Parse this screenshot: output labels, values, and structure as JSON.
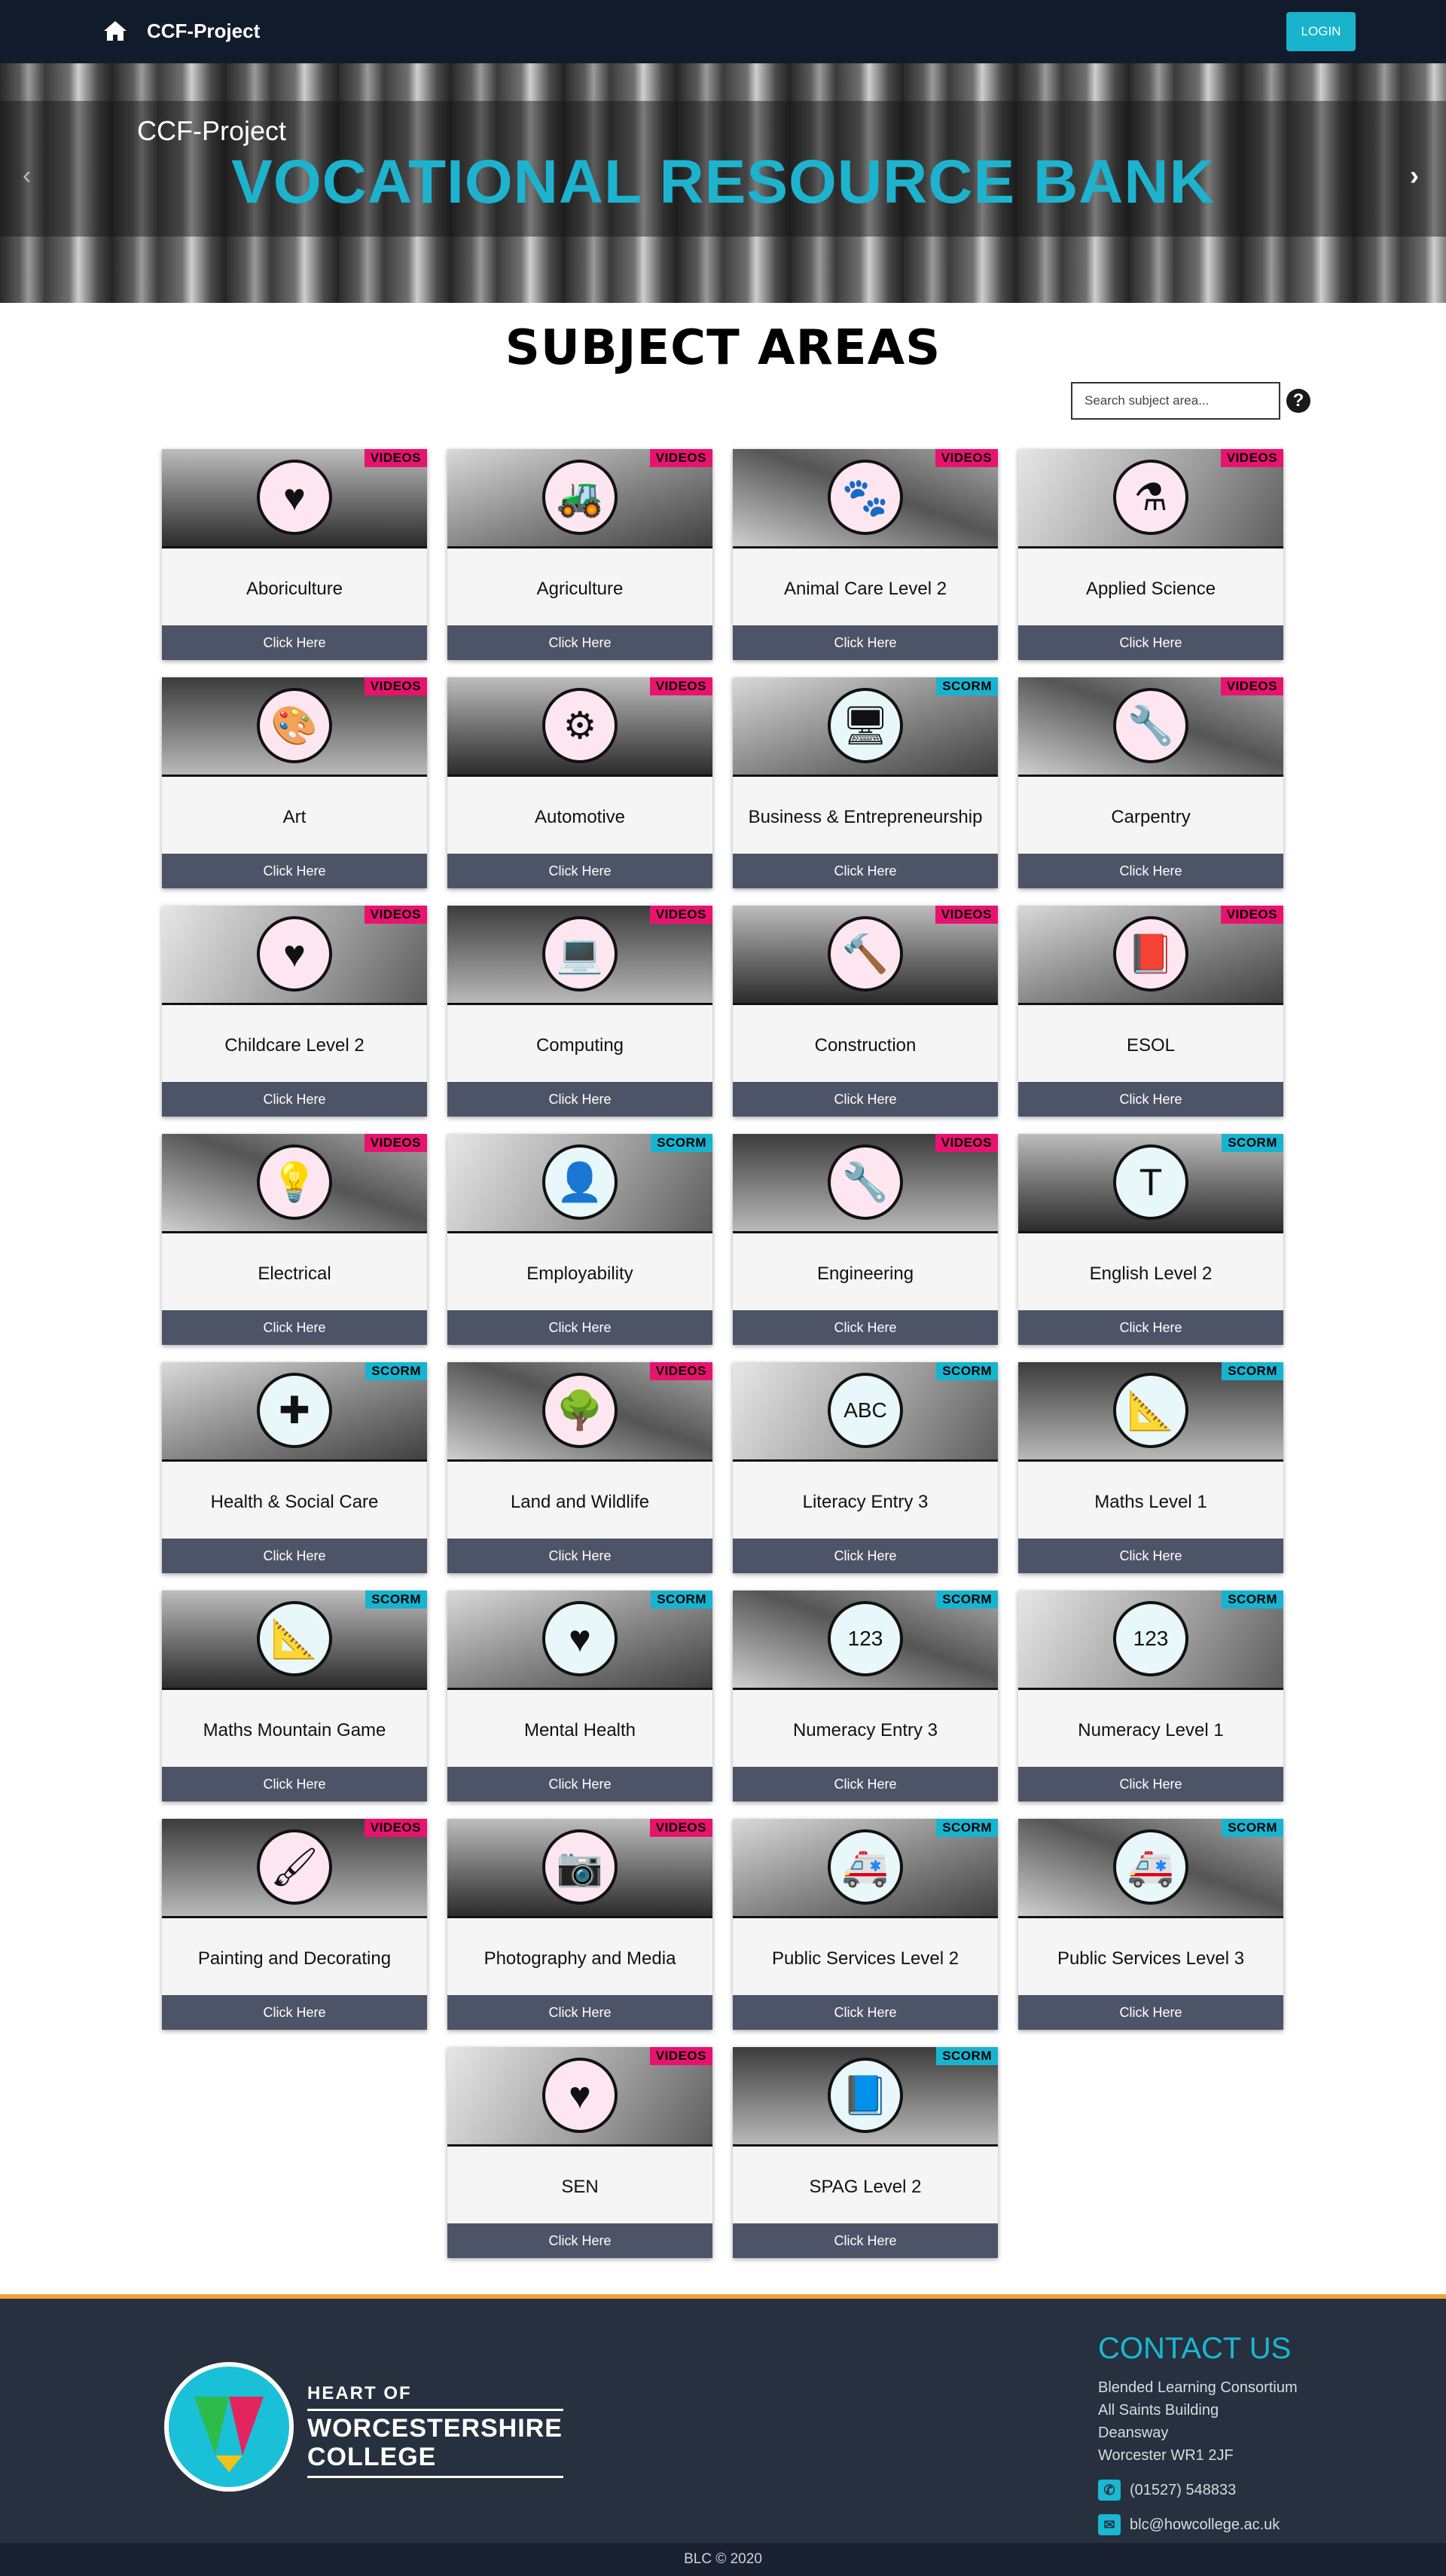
{
  "nav": {
    "brand": "CCF-Project",
    "login_label": "LOGIN",
    "home_icon": "home-icon"
  },
  "hero": {
    "subtitle": "CCF-Project",
    "title": "VOCATIONAL RESOURCE BANK",
    "prev_icon": "chevron-left-icon",
    "next_icon": "chevron-right-icon"
  },
  "subjects": {
    "title": "SUBJECT AREAS",
    "search_placeholder": "Search subject area...",
    "help_icon": "question-circle-icon",
    "cards": [
      {
        "title": "Aboriculture",
        "tag": "VIDEOS",
        "button": "Click Here",
        "icon": "heart-brush-icon",
        "glyph": "♥"
      },
      {
        "title": "Agriculture",
        "tag": "VIDEOS",
        "button": "Click Here",
        "icon": "tractor-icon",
        "glyph": "🚜"
      },
      {
        "title": "Animal Care Level 2",
        "tag": "VIDEOS",
        "button": "Click Here",
        "icon": "paw-heart-icon",
        "glyph": "🐾"
      },
      {
        "title": "Applied Science",
        "tag": "VIDEOS",
        "button": "Click Here",
        "icon": "petri-dish-icon",
        "glyph": "⚗"
      },
      {
        "title": "Art",
        "tag": "VIDEOS",
        "button": "Click Here",
        "icon": "palette-icon",
        "glyph": "🎨"
      },
      {
        "title": "Automotive",
        "tag": "VIDEOS",
        "button": "Click Here",
        "icon": "oil-can-gear-icon",
        "glyph": "⚙"
      },
      {
        "title": "Business & Entrepreneurship",
        "tag": "SCORM",
        "button": "Click Here",
        "icon": "monitor-shop-icon",
        "glyph": "🖥"
      },
      {
        "title": "Carpentry",
        "tag": "VIDEOS",
        "button": "Click Here",
        "icon": "drill-saw-icon",
        "glyph": "🔧"
      },
      {
        "title": "Childcare Level 2",
        "tag": "VIDEOS",
        "button": "Click Here",
        "icon": "child-heart-icon",
        "glyph": "♥"
      },
      {
        "title": "Computing",
        "tag": "VIDEOS",
        "button": "Click Here",
        "icon": "computer-icon",
        "glyph": "💻"
      },
      {
        "title": "Construction",
        "tag": "VIDEOS",
        "button": "Click Here",
        "icon": "drill-icon",
        "glyph": "🔨"
      },
      {
        "title": "ESOL",
        "tag": "VIDEOS",
        "button": "Click Here",
        "icon": "abc-book-icon",
        "glyph": "📕"
      },
      {
        "title": "Electrical",
        "tag": "VIDEOS",
        "button": "Click Here",
        "icon": "lightbulb-icon",
        "glyph": "💡"
      },
      {
        "title": "Employability",
        "tag": "SCORM",
        "button": "Click Here",
        "icon": "person-chart-icon",
        "glyph": "👤"
      },
      {
        "title": "Engineering",
        "tag": "VIDEOS",
        "button": "Click Here",
        "icon": "wrench-gear-icon",
        "glyph": "🔧"
      },
      {
        "title": "English Level 2",
        "tag": "SCORM",
        "button": "Click Here",
        "icon": "text-letter-icon",
        "glyph": "T"
      },
      {
        "title": "Health & Social Care",
        "tag": "SCORM",
        "button": "Click Here",
        "icon": "hands-cross-icon",
        "glyph": "✚"
      },
      {
        "title": "Land and Wildlife",
        "tag": "VIDEOS",
        "button": "Click Here",
        "icon": "tree-icon",
        "glyph": "🌳"
      },
      {
        "title": "Literacy Entry 3",
        "tag": "SCORM",
        "button": "Click Here",
        "icon": "abc-screen-icon",
        "glyph": "ABC"
      },
      {
        "title": "Maths Level 1",
        "tag": "SCORM",
        "button": "Click Here",
        "icon": "ruler-pencil-icon",
        "glyph": "📐"
      },
      {
        "title": "Maths Mountain Game",
        "tag": "SCORM",
        "button": "Click Here",
        "icon": "ruler-pencil-icon",
        "glyph": "📐"
      },
      {
        "title": "Mental Health",
        "tag": "SCORM",
        "button": "Click Here",
        "icon": "heart-brain-icon",
        "glyph": "♥"
      },
      {
        "title": "Numeracy Entry 3",
        "tag": "SCORM",
        "button": "Click Here",
        "icon": "number-blocks-icon",
        "glyph": "123"
      },
      {
        "title": "Numeracy Level 1",
        "tag": "SCORM",
        "button": "Click Here",
        "icon": "number-blocks-icon",
        "glyph": "123"
      },
      {
        "title": "Painting and Decorating",
        "tag": "VIDEOS",
        "button": "Click Here",
        "icon": "paintbrush-icon",
        "glyph": "🖌"
      },
      {
        "title": "Photography and Media",
        "tag": "VIDEOS",
        "button": "Click Here",
        "icon": "camera-icon",
        "glyph": "📷"
      },
      {
        "title": "Public Services Level 2",
        "tag": "SCORM",
        "button": "Click Here",
        "icon": "ambulance-icon",
        "glyph": "🚑"
      },
      {
        "title": "Public Services Level 3",
        "tag": "SCORM",
        "button": "Click Here",
        "icon": "ambulance-icon",
        "glyph": "🚑"
      },
      {
        "title": "SEN",
        "tag": "VIDEOS",
        "button": "Click Here",
        "icon": "heart-cap-icon",
        "glyph": "♥"
      },
      {
        "title": "SPAG Level 2",
        "tag": "SCORM",
        "button": "Click Here",
        "icon": "spag-book-icon",
        "glyph": "📘"
      }
    ]
  },
  "footer": {
    "logo_line1": "HEART OF",
    "logo_line2": "WORCESTERSHIRE",
    "logo_line3": "COLLEGE",
    "contact_title": "CONTACT US",
    "address": [
      "Blended Learning Consortium",
      "All Saints Building",
      "Deansway",
      "Worcester WR1 2JF"
    ],
    "phone": "(01527) 548833",
    "email": "blc@howcollege.ac.uk",
    "phone_icon": "phone-icon",
    "email_icon": "envelope-icon",
    "copyright": "BLC © 2020"
  },
  "colors": {
    "nav_bg": "#111b2b",
    "accent": "#1ab3cd",
    "videos_tag": "#e8136f",
    "scorm_tag": "#18b4cf",
    "card_button": "#4e5468",
    "footer_bg": "#27303f",
    "footer_border": "#f0a23a"
  }
}
